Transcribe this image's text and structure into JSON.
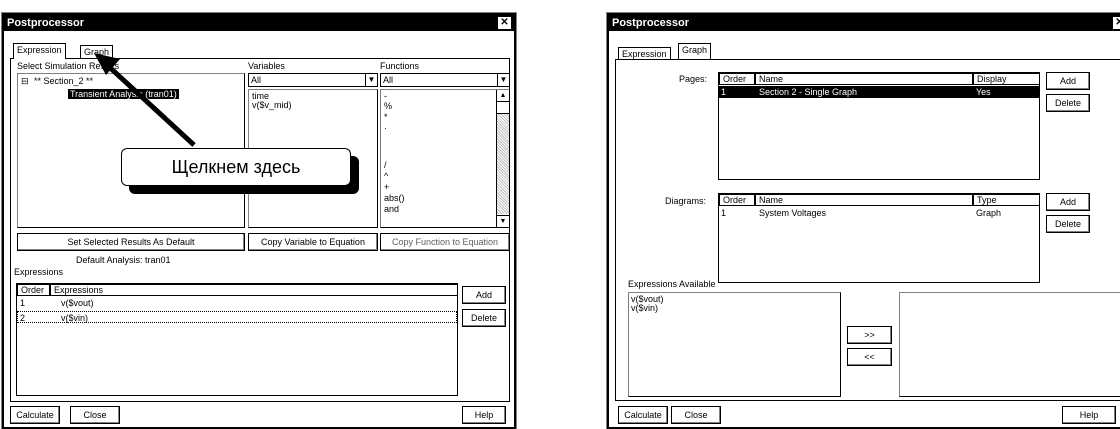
{
  "left": {
    "title": "Postprocessor",
    "close_glyph": "✕",
    "tabs": [
      "Expression",
      "Graph"
    ],
    "select_results_label": "Select Simulation Results",
    "tree": {
      "root": "** Section_2 **",
      "expander": "⊟",
      "child": "Transient Analysis (tran01)"
    },
    "variables_label": "Variables",
    "variables_filter": "All",
    "variables": [
      "time",
      "v($v_mid)"
    ],
    "functions_label": "Functions",
    "functions_filter": "All",
    "functions": [
      "-",
      "%",
      "*",
      "·",
      "/",
      "^",
      "+",
      "abs()",
      "and"
    ],
    "btn_set_default": "Set Selected Results As Default",
    "btn_copy_variable": "Copy Variable to Equation",
    "btn_copy_function": "Copy Function to Equation",
    "default_analysis": "Default Analysis: tran01",
    "expressions_label": "Expressions",
    "expr_headers": [
      "Order",
      "Expressions"
    ],
    "expr_rows": [
      {
        "order": "1",
        "expr": "v($vout)"
      },
      {
        "order": "2",
        "expr": "v($vin)"
      }
    ],
    "btn_add": "Add",
    "btn_delete": "Delete",
    "btn_calculate": "Calculate",
    "btn_close": "Close",
    "btn_help": "Help"
  },
  "callout": {
    "text": "Щелкнем здесь"
  },
  "right": {
    "title": "Postprocessor",
    "close_glyph": "✕",
    "tabs": [
      "Expression",
      "Graph"
    ],
    "pages_label": "Pages:",
    "pages_headers": [
      "Order",
      "Name",
      "Display"
    ],
    "pages_rows": [
      {
        "order": "1",
        "name": "Section 2 - Single Graph",
        "display": "Yes"
      }
    ],
    "diagrams_label": "Diagrams:",
    "diagrams_headers": [
      "Order",
      "Name",
      "Type"
    ],
    "diagrams_rows": [
      {
        "order": "1",
        "name": "System Voltages",
        "type": "Graph"
      }
    ],
    "btn_add": "Add",
    "btn_delete": "Delete",
    "expr_available_label": "Expressions Available",
    "expr_available": [
      "v($vout)",
      "v($vin)"
    ],
    "btn_move_right": ">>",
    "btn_move_left": "<<",
    "btn_calculate": "Calculate",
    "btn_close": "Close",
    "btn_help": "Help"
  }
}
